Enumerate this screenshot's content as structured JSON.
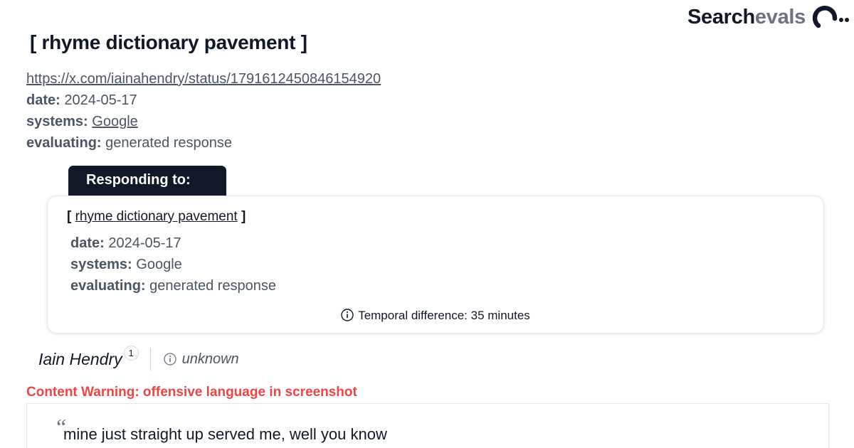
{
  "brand": {
    "part1": "Search",
    "part2": "evals",
    "logo_icon": "searchevals-logo-icon"
  },
  "header": {
    "title": "[ rhyme dictionary pavement ]",
    "url": "https://x.com/iainahendry/status/1791612450846154920",
    "date_label": "date:",
    "date_value": "2024-05-17",
    "systems_label": "systems:",
    "systems_value": "Google",
    "evaluating_label": "evaluating:",
    "evaluating_value": "generated response"
  },
  "responding_to": {
    "tab_label": "Responding to:",
    "bracket_open": "[",
    "title_link": "rhyme dictionary pavement",
    "bracket_close": "]",
    "date_label": "date:",
    "date_value": "2024-05-17",
    "systems_label": "systems:",
    "systems_value": "Google",
    "evaluating_label": "evaluating:",
    "evaluating_value": "generated response",
    "temporal_text": "Temporal difference: 35 minutes"
  },
  "author": {
    "name": "Iain Hendry",
    "count": "1",
    "status": "unknown"
  },
  "warning": "Content Warning: offensive language in screenshot",
  "quote": {
    "mark": "“",
    "text": "mine just straight up served me, well you know"
  },
  "colors": {
    "dark": "#111827",
    "muted": "#4b5563",
    "warning": "#ef4444",
    "border": "#e5e7eb"
  }
}
